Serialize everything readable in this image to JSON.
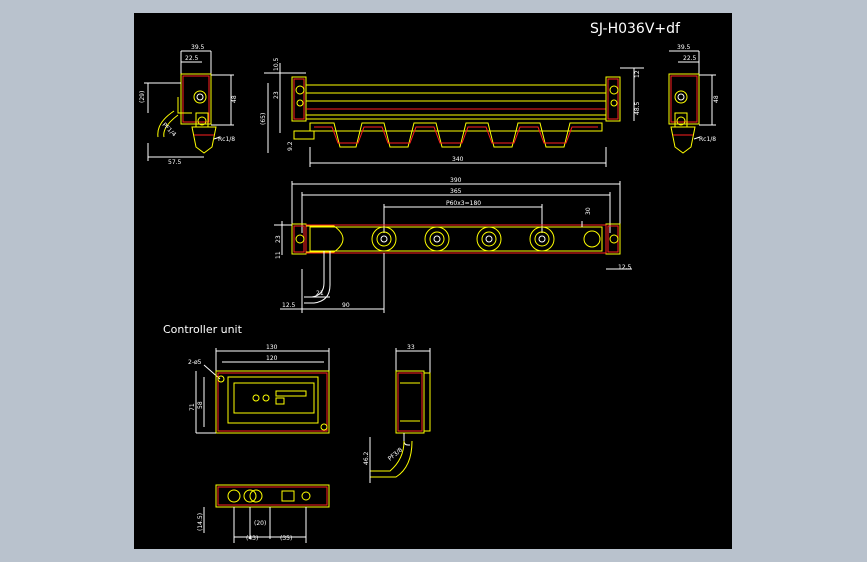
{
  "title": "SJ-H036V+df",
  "section_title": "Controller unit",
  "colors": {
    "background": "#000000",
    "frame": "#b9c2cd",
    "outline": "#ffff00",
    "detail": "#ff2020",
    "dimension": "#ffffff"
  },
  "side_left": {
    "dims": {
      "w395": "39.5",
      "w225": "22.5",
      "h29": "(29)",
      "h48": "48",
      "w575": "57.5",
      "rc": "Rc1/8",
      "pf": "PF1/4"
    }
  },
  "front": {
    "dims": {
      "d105": "10.5",
      "d23": "23",
      "d65": "(65)",
      "d92": "9.2",
      "d340": "340",
      "d12": "12",
      "d485": "48.5"
    }
  },
  "side_right": {
    "dims": {
      "w395": "39.5",
      "w225": "22.5",
      "h48": "48",
      "rc": "Rc1/8"
    }
  },
  "top_view": {
    "dims": {
      "d390": "390",
      "d365": "365",
      "pitch": "P60x3=180",
      "d30": "30",
      "d23": "23",
      "d11": "11",
      "d125r": "12.5",
      "d21": "21",
      "d125l": "12.5",
      "d90": "90"
    }
  },
  "controller_front": {
    "dims": {
      "w130": "130",
      "w120": "120",
      "holes": "2-ø5",
      "h71": "71",
      "h58": "58"
    }
  },
  "controller_side": {
    "dims": {
      "w33": "33",
      "h462": "46.2",
      "pf": "PF3/8"
    }
  },
  "controller_bottom": {
    "dims": {
      "d145": "(14.5)",
      "d20": "(20)",
      "d43": "(43)",
      "d35": "(35)"
    }
  }
}
